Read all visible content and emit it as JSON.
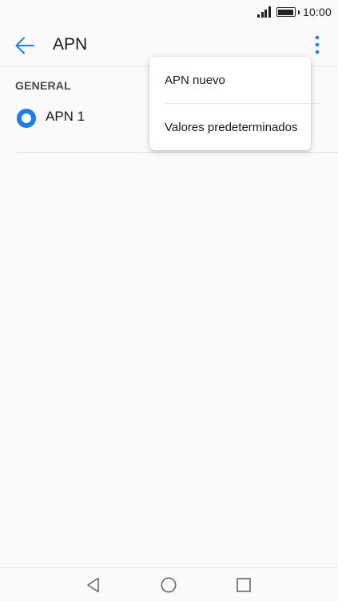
{
  "status_bar": {
    "time": "10:00",
    "signal_icon": "signal-icon",
    "battery_icon": "battery-icon",
    "battery_level": 1.0
  },
  "toolbar": {
    "title": "APN",
    "back_icon": "arrow-back-icon",
    "more_icon": "more-vert-icon",
    "accent_color": "#1a7ef0"
  },
  "content": {
    "section_header": "GENERAL",
    "apn_items": [
      {
        "label": "APN 1",
        "selected": true
      }
    ]
  },
  "menu": {
    "items": [
      {
        "label": "APN nuevo"
      },
      {
        "label": "Valores predeterminados"
      }
    ]
  },
  "nav_bar": {
    "back_icon": "triangle-back-icon",
    "home_icon": "circle-home-icon",
    "recent_icon": "square-recent-icon"
  }
}
